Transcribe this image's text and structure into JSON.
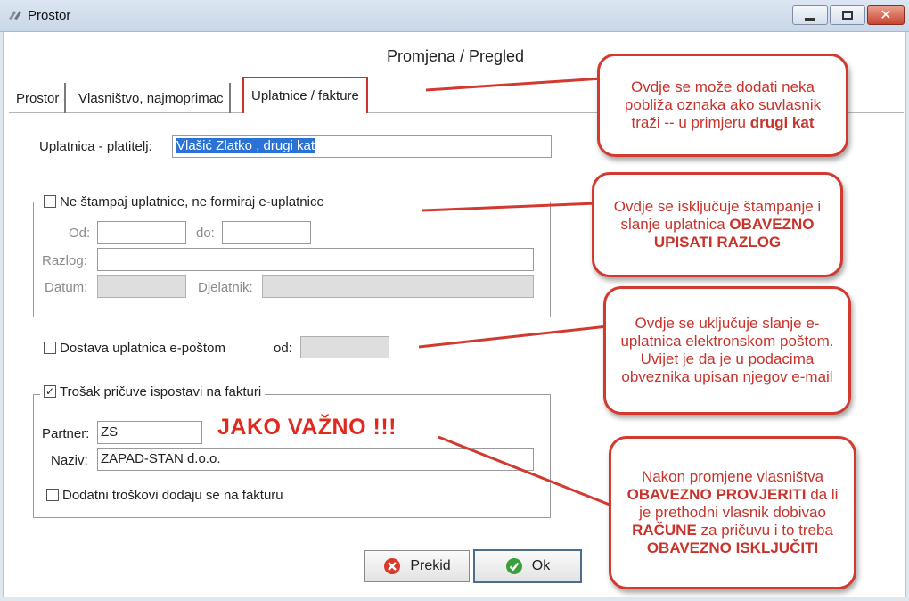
{
  "window": {
    "title": "Prostor"
  },
  "form": {
    "title": "Promjena / Pregled"
  },
  "tabs": [
    {
      "label": "Prostor"
    },
    {
      "label": "Vlasništvo, najmoprimac"
    },
    {
      "label": "Uplatnice / fakture"
    }
  ],
  "payer": {
    "label": "Uplatnica - platitelj:",
    "value": "Vlašić Zlatko , drugi kat"
  },
  "no_print": {
    "label": "Ne štampaj uplatnice, ne formiraj e-uplatnice",
    "from_label": "Od:",
    "to_label": "do:",
    "reason_label": "Razlog:",
    "date_label": "Datum:",
    "employee_label": "Djelatnik:"
  },
  "email": {
    "label": "Dostava uplatnica e-poštom",
    "from_label": "od:"
  },
  "invoice": {
    "label": "Trošak pričuve ispostavi na fakturi",
    "partner_label": "Partner:",
    "partner_value": "ZS",
    "name_label": "Naziv:",
    "name_value": "ZAPAD-STAN d.o.o.",
    "extra_label": "Dodatni troškovi dodaju se na fakturu"
  },
  "buttons": {
    "cancel": "Prekid",
    "ok": "Ok"
  },
  "annotations": {
    "important": "JAKO VAŽNO !!!",
    "c1": {
      "text": "Ovdje se može dodati neka pobliža oznaka ako suvlasnik traži -- u primjeru",
      "bold": "drugi kat"
    },
    "c2": {
      "text": "Ovdje se isključuje štampanje i slanje uplatnica",
      "bold": "OBAVEZNO UPISATI RAZLOG"
    },
    "c3": {
      "text": "Ovdje se uključuje slanje e-uplatnica elektronskom poštom. Uvijet je da je u podacima obveznika upisan njegov e-mail"
    },
    "c4": {
      "t1": "Nakon promjene vlasništva",
      "b1": "OBAVEZNO PROVJERITI",
      "t2": "da li je prethodni vlasnik dobivao",
      "b2": "RAČUNE",
      "t3": "za pričuvu i to treba",
      "b3": "OBAVEZNO ISKLJUČITI"
    }
  },
  "colors": {
    "accent_red": "#d23a30",
    "selection_blue": "#2a72d6"
  }
}
